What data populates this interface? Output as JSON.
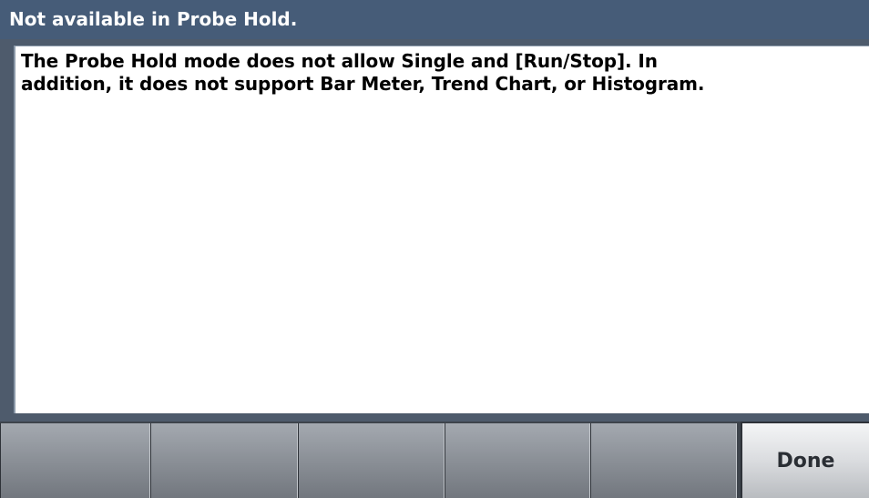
{
  "dialog": {
    "title": "Not available in Probe Hold.",
    "message_line1": "The Probe Hold mode does not allow Single and [Run/Stop]. In",
    "message_line2": "addition, it does not support Bar Meter, Trend Chart, or Histogram."
  },
  "softkeys": [
    {
      "label": ""
    },
    {
      "label": ""
    },
    {
      "label": ""
    },
    {
      "label": ""
    },
    {
      "label": ""
    },
    {
      "label": "Done"
    }
  ],
  "colors": {
    "title_bar": "#465c78",
    "frame": "#4e5b6c",
    "panel": "#ffffff",
    "softkey_bar": "#3e444c"
  }
}
